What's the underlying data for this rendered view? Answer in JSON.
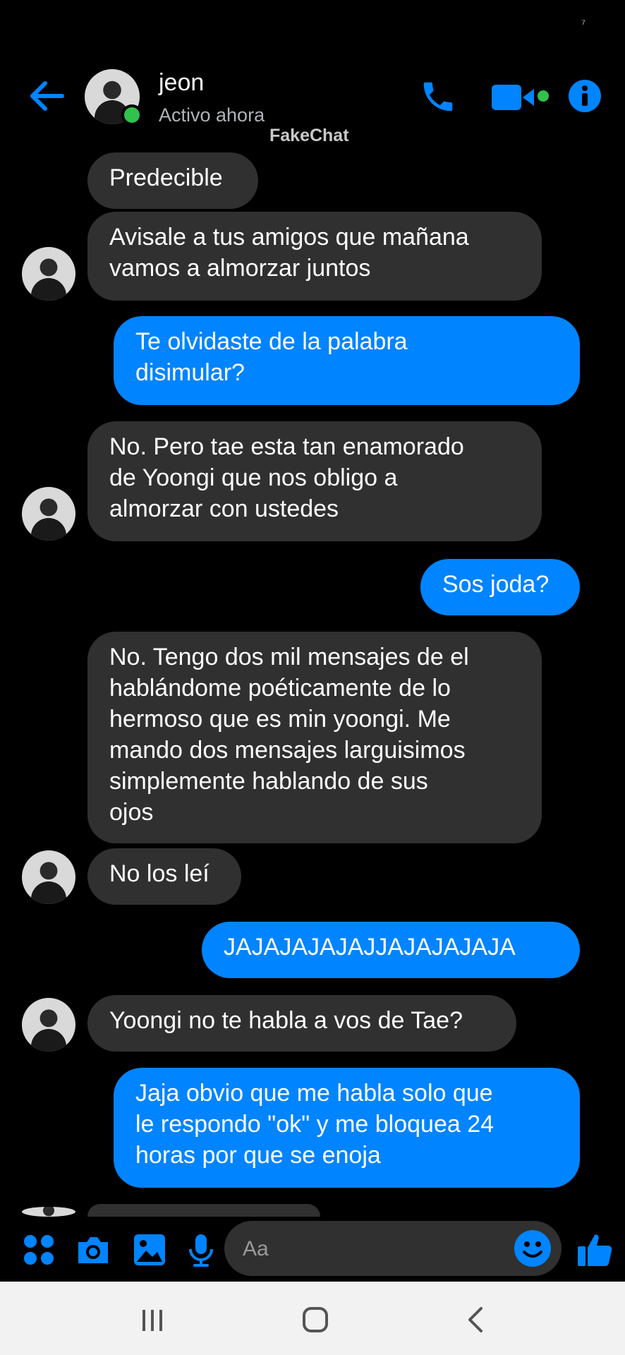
{
  "status_bar": {
    "glyph": "⁷"
  },
  "header": {
    "contact_name": "jeon",
    "contact_status": "Activo ahora",
    "watermark": "FakeChat",
    "icons": [
      "back-arrow-icon",
      "phone-icon",
      "video-camera-icon",
      "info-icon"
    ]
  },
  "messages": [
    {
      "from": "them",
      "text": "Predecible"
    },
    {
      "from": "them",
      "text": "Avisale a tus amigos que mañana\nvamos a almorzar juntos"
    },
    {
      "from": "me",
      "text": "Te olvidaste de la palabra\ndisimular?"
    },
    {
      "from": "them",
      "text": "No. Pero tae esta tan enamorado\nde Yoongi que nos obligo a\nalmorzar con ustedes"
    },
    {
      "from": "me",
      "text": "Sos joda?"
    },
    {
      "from": "them",
      "text": "No. Tengo dos mil mensajes de el\nhablándome poéticamente de lo\nhermoso que es min yoongi. Me\nmando dos mensajes larguisimos\nsimplemente hablando de sus\nojos"
    },
    {
      "from": "them",
      "text": "No los leí"
    },
    {
      "from": "me",
      "text": "JAJAJAJAJAJJAJAJAJAJA"
    },
    {
      "from": "them",
      "text": "Yoongi no te habla a vos de Tae?"
    },
    {
      "from": "me",
      "text": "Jaja obvio que me habla solo que\nle respondo \"ok\" y me bloquea 24\nhoras por que se enoja"
    }
  ],
  "composer": {
    "placeholder": "Aa",
    "icons": [
      "apps-grid-icon",
      "camera-icon",
      "image-icon",
      "microphone-icon",
      "emoji-icon",
      "thumbs-up-icon"
    ]
  },
  "colors": {
    "accent": "#0084ff",
    "incoming_bubble": "#303030",
    "online": "#31c24d"
  }
}
